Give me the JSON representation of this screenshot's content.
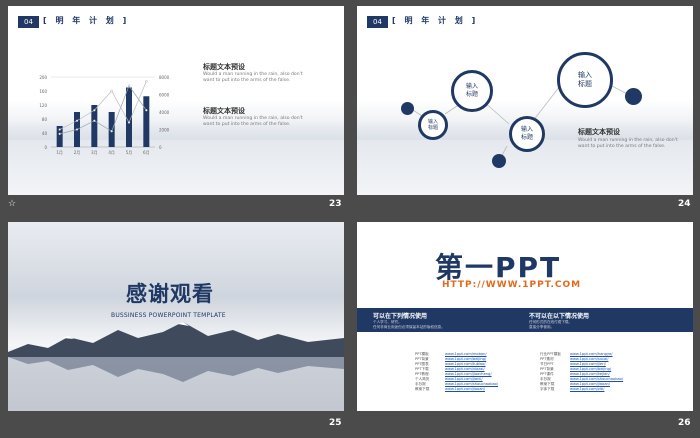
{
  "footer": {
    "left_glyph": "☆"
  },
  "slide1": {
    "num": "23",
    "badge": "04",
    "section": "[ 明 年 计 划 ]",
    "items": [
      {
        "title": "标题文本预设",
        "body": "Would a man running in the rain, also don't want to put into the arms of the false."
      },
      {
        "title": "标题文本预设",
        "body": "Would a man running in the rain, also don't want to put into the arms of the false."
      }
    ]
  },
  "slide2": {
    "num": "24",
    "badge": "04",
    "section": "[ 明 年 计 划 ]",
    "circles": {
      "c1": "输入\n标题",
      "c2": "输入\n标题",
      "c3": "输入\n标题",
      "c4": "输入\n标题"
    },
    "item": {
      "title": "标题文本预设",
      "body": "Would a man running in the rain, also don't want to put into the arms of the false."
    }
  },
  "slide3": {
    "num": "25",
    "title": "感谢观看",
    "subtitle": "BUSSINESS POWERPOINT TEMPLATE"
  },
  "slide4": {
    "num": "26",
    "logo": "第一PPT",
    "url": "HTTP://WWW.1PPT.COM",
    "left_head": "可以在下列情况使用",
    "right_head": "不可以在以下情况使用",
    "left_list": [
      "个人学习、研究。",
      "任何非商业用途但必须保留本站的版权信息。"
    ],
    "right_list": [
      "任何形式的在线付费下载。",
      "直接分享使用。"
    ],
    "link_labels": [
      "PPT模板",
      "PPT背景",
      "PPT图表",
      "PPT下载",
      "PPT教程",
      "个人简历",
      "手抄报",
      "教案下载"
    ],
    "link_urls": [
      "www.1ppt.com/moban/",
      "www.1ppt.com/beijing/",
      "www.1ppt.com/tubiao/",
      "www.1ppt.com/xiazai/",
      "www.1ppt.com/jiaocheng/",
      "www.1ppt.com/jianli/",
      "www.1ppt.com/shouchaobao/",
      "www.1ppt.com/jiaoan/"
    ],
    "link_labels2": [
      "行业PPT模板",
      "PPT素材",
      "节日PPT",
      "PPT背景",
      "PPT课件",
      "手抄报",
      "教案下载",
      "字体下载"
    ],
    "link_urls2": [
      "www.1ppt.com/hangye/",
      "www.1ppt.com/sucai/",
      "www.1ppt.com/jieri/",
      "www.1ppt.com/beijing/",
      "www.1ppt.com/kejian/",
      "www.1ppt.com/shouchaobao/",
      "www.1ppt.com/jiaoan/",
      "www.1ppt.com/ziti/"
    ]
  },
  "chart_data": {
    "type": "bar",
    "categories": [
      "1月",
      "2月",
      "3月",
      "4月",
      "5月",
      "6月"
    ],
    "series": [
      {
        "values": [
          60,
          100,
          120,
          100,
          170,
          145
        ]
      },
      {
        "values": [
          1500,
          2000,
          3000,
          1800,
          7000,
          4200
        ]
      },
      {
        "values": [
          2000,
          3000,
          4200,
          6400,
          2800,
          7500
        ]
      }
    ],
    "ylim_left": [
      0,
      200
    ],
    "ylim_right": [
      0,
      8000
    ],
    "left_ticks": [
      "200",
      "160",
      "120",
      "80",
      "40",
      "0"
    ],
    "right_ticks": [
      "8000",
      "6000",
      "4000",
      "2000",
      "0"
    ],
    "grid": false
  }
}
